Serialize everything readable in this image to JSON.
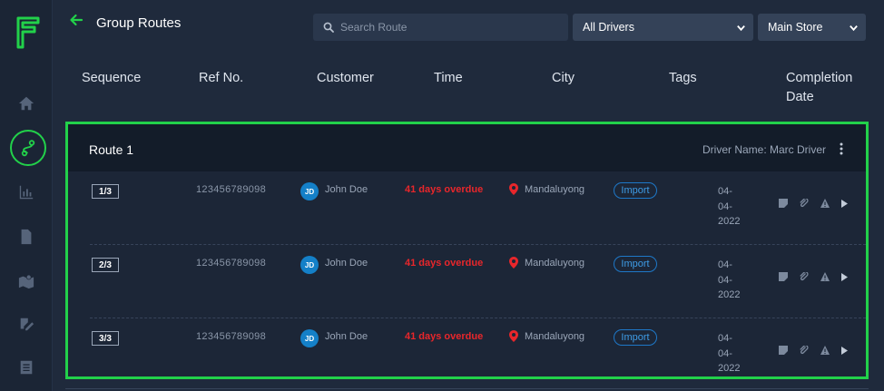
{
  "header": {
    "title": "Group Routes",
    "search_placeholder": "Search Route",
    "drivers_select": "All Drivers",
    "store_select": "Main Store"
  },
  "columns": {
    "sequence": "Sequence",
    "ref": "Ref No.",
    "customer": "Customer",
    "time": "Time",
    "city": "City",
    "tags": "Tags",
    "completion_line1": "Completion",
    "completion_line2": "Date"
  },
  "route": {
    "title": "Route 1",
    "driver_label": "Driver Name: Marc Driver",
    "rows": [
      {
        "sequence": "1/3",
        "ref": "123456789098",
        "avatar": "JD",
        "customer": "John Doe",
        "time": "41 days overdue",
        "city": "Mandaluyong",
        "tag": "Import",
        "date_1": "04-",
        "date_2": "04-",
        "date_3": "2022"
      },
      {
        "sequence": "2/3",
        "ref": "123456789098",
        "avatar": "JD",
        "customer": "John Doe",
        "time": "41 days overdue",
        "city": "Mandaluyong",
        "tag": "Import",
        "date_1": "04-",
        "date_2": "04-",
        "date_3": "2022"
      },
      {
        "sequence": "3/3",
        "ref": "123456789098",
        "avatar": "JD",
        "customer": "John Doe",
        "time": "41 days overdue",
        "city": "Mandaluyong",
        "tag": "Import",
        "date_1": "04-",
        "date_2": "04-",
        "date_3": "2022"
      }
    ]
  },
  "colors": {
    "accent_green": "#22d14a",
    "overdue_red": "#e8262b",
    "tag_blue": "#1e78c8",
    "avatar_blue": "#1480c8"
  },
  "icons": {
    "sidebar": [
      "home-icon",
      "routes-icon",
      "chart-icon",
      "document-icon",
      "map-icon",
      "edit-icon",
      "list-icon"
    ],
    "row": [
      "note-icon",
      "attachment-icon",
      "warning-icon",
      "caret-right-icon"
    ]
  }
}
